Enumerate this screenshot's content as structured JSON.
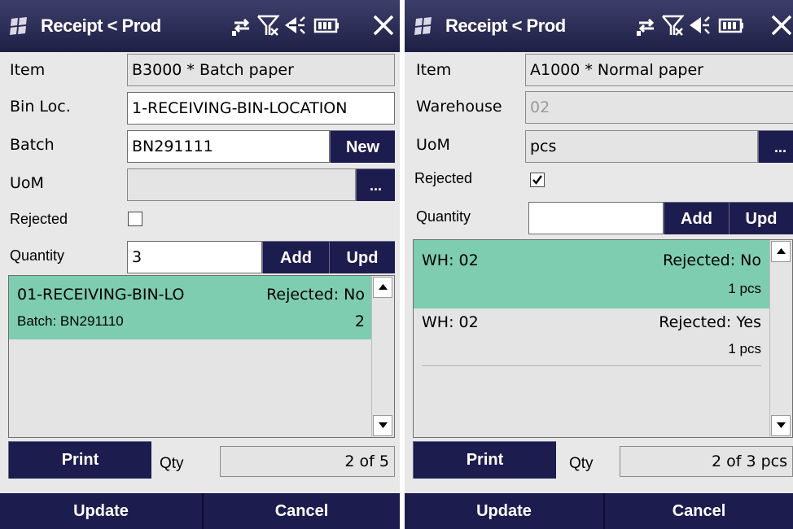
{
  "screens": [
    {
      "title": "Receipt < Prod",
      "fields": {
        "item_label": "Item",
        "item_value": "B3000 * Batch paper",
        "bin_label": "Bin Loc.",
        "bin_value": "1-RECEIVING-BIN-LOCATION",
        "batch_label": "Batch",
        "batch_value": "BN291111",
        "new_label": "New",
        "uom_label": "UoM",
        "uom_value": "",
        "uom_button": "...",
        "rejected_label": "Rejected",
        "rejected_checked": false,
        "quantity_label": "Quantity",
        "quantity_value": "3",
        "add_label": "Add",
        "upd_label": "Upd"
      },
      "list": [
        {
          "line1_left": "01-RECEIVING-BIN-LO",
          "line1_right": "Rejected: No",
          "line2_left": "Batch: BN291110",
          "line2_right": "2",
          "selected": true
        }
      ],
      "bottom": {
        "print_label": "Print",
        "qty_label": "Qty",
        "qty_value": "2 of 5"
      },
      "footer": {
        "update_label": "Update",
        "cancel_label": "Cancel"
      }
    },
    {
      "title": "Receipt < Prod",
      "fields": {
        "item_label": "Item",
        "item_value": "A1000 * Normal paper",
        "warehouse_label": "Warehouse",
        "warehouse_value": "02",
        "uom_label": "UoM",
        "uom_value": "pcs",
        "uom_button": "...",
        "rejected_label": "Rejected",
        "rejected_checked": true,
        "quantity_label": "Quantity",
        "quantity_value": "",
        "add_label": "Add",
        "upd_label": "Upd"
      },
      "list": [
        {
          "line1_left": "WH: 02",
          "line1_right": "Rejected: No",
          "line2_right": "1 pcs",
          "selected": true
        },
        {
          "line1_left": "WH: 02",
          "line1_right": "Rejected: Yes",
          "line2_right": "1 pcs",
          "selected": false
        }
      ],
      "bottom": {
        "print_label": "Print",
        "qty_label": "Qty",
        "qty_value": "2 of 3 pcs"
      },
      "footer": {
        "update_label": "Update",
        "cancel_label": "Cancel"
      }
    }
  ],
  "icons": [
    "windows-start-icon",
    "connectivity-icon",
    "no-signal-icon",
    "volume-muted-icon",
    "battery-icon",
    "close-icon"
  ],
  "colors": {
    "titlebar": "#1d1f45",
    "button": "#1d1c4f",
    "selected_row": "#7ecdb0",
    "readonly_field": "#e4e4e4"
  }
}
